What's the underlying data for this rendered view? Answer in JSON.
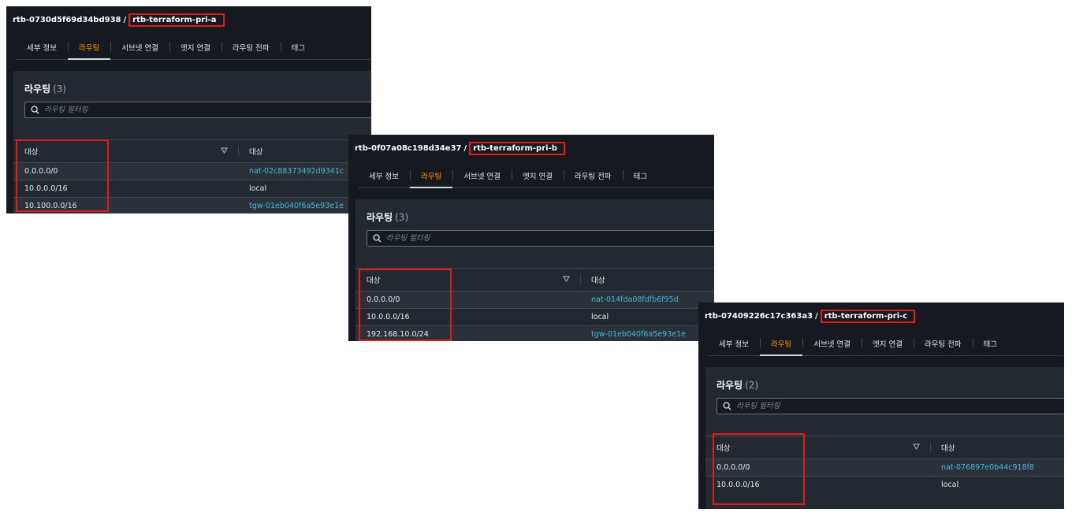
{
  "panels": [
    {
      "route_table_id": "rtb-0730d5f69d34bd938",
      "separator": "/",
      "route_table_name": "rtb-terraform-pri-a",
      "tabs": [
        "세부 정보",
        "라우팅",
        "서브넷 연결",
        "엣지 연결",
        "라우팅 전파",
        "태그"
      ],
      "active_tab": 1,
      "section_title": "라우팅",
      "section_count": "(3)",
      "search_placeholder": "라우팅 필터링",
      "columns": [
        "대상",
        "대상"
      ],
      "rows": [
        {
          "destination": "0.0.0.0/0",
          "target": "nat-02c88373492d9341c"
        },
        {
          "destination": "10.0.0.0/16",
          "target": "local"
        },
        {
          "destination": "10.100.0.0/16",
          "target": "tgw-01eb040f6a5e93e1e"
        }
      ]
    },
    {
      "route_table_id": "rtb-0f07a08c198d34e37",
      "separator": "/",
      "route_table_name": "rtb-terraform-pri-b",
      "tabs": [
        "세부 정보",
        "라우팅",
        "서브넷 연결",
        "엣지 연결",
        "라우팅 전파",
        "태그"
      ],
      "active_tab": 1,
      "section_title": "라우팅",
      "section_count": "(3)",
      "search_placeholder": "라우팅 필터링",
      "columns": [
        "대상",
        "대상"
      ],
      "rows": [
        {
          "destination": "0.0.0.0/0",
          "target": "nat-014fda08fdfb6f95d"
        },
        {
          "destination": "10.0.0.0/16",
          "target": "local"
        },
        {
          "destination": "192.168.10.0/24",
          "target": "tgw-01eb040f6a5e93e1e"
        }
      ]
    },
    {
      "route_table_id": "rtb-07409226c17c363a3",
      "separator": "/",
      "route_table_name": "rtb-terraform-pri-c",
      "tabs": [
        "세부 정보",
        "라우팅",
        "서브넷 연결",
        "엣지 연결",
        "라우팅 전파",
        "태그"
      ],
      "active_tab": 1,
      "section_title": "라우팅",
      "section_count": "(2)",
      "search_placeholder": "라우팅 필터링",
      "columns": [
        "대상",
        "대상"
      ],
      "rows": [
        {
          "destination": "0.0.0.0/0",
          "target": "nat-076897e0b44c918f8"
        },
        {
          "destination": "10.0.0.0/16",
          "target": "local"
        }
      ]
    }
  ],
  "colors": {
    "panel_bg": "#16191f",
    "container_bg": "#232931",
    "active_tab": "#ff9900",
    "link": "#44b9d6",
    "highlight_box": "#e01b1b"
  },
  "icons": {
    "search": "search-icon",
    "sort": "sort-triangle-icon"
  }
}
